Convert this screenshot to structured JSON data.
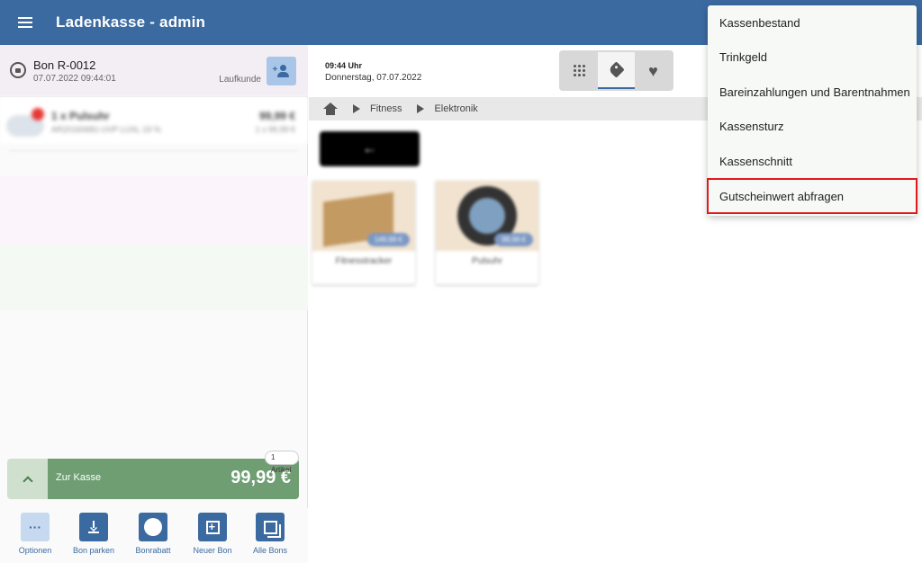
{
  "header": {
    "title": "Ladenkasse - admin",
    "menu_icon": "hamburger-menu-icon"
  },
  "bon": {
    "title": "Bon R-0012",
    "datetime": "07.07.2022 09:44:01",
    "customer": "Laufkunde"
  },
  "cart": {
    "items": [
      {
        "name": "1 x Pulsuhr",
        "sub": "AR20160681-UVP LUXL 19 %",
        "price": "99,99 €",
        "qty_price": "1 x 99,99 €",
        "badge_color": "#e53935"
      }
    ]
  },
  "checkout": {
    "label": "Zur Kasse",
    "total": "99,99 €",
    "article_count": "1 Artikel",
    "color": "#6e9e72"
  },
  "toolbar": {
    "options": "Optionen",
    "park": "Bon parken",
    "discount": "Bonrabatt",
    "new_bon": "Neuer Bon",
    "all_bons": "Alle Bons"
  },
  "main": {
    "time": "09:44 Uhr",
    "date": "Donnerstag,  07.07.2022",
    "tabs": [
      "numpad-icon",
      "tag-icon",
      "heart-icon"
    ],
    "active_tab": 1,
    "breadcrumb": [
      "Fitness",
      "Elektronik"
    ],
    "back_arrow": "←",
    "products": [
      {
        "name": "Fitnesstracker",
        "price": "149,99 €"
      },
      {
        "name": "Pulsuhr",
        "price": "99,99 €"
      }
    ]
  },
  "menu": {
    "items": [
      "Kassenbestand",
      "Trinkgeld",
      "Bareinzahlungen und Barentnahmen",
      "Kassensturz",
      "Kassenschnitt",
      "Gutscheinwert abfragen"
    ],
    "highlighted_index": 5,
    "highlight_color": "#e0191e"
  },
  "colors": {
    "primary": "#3b6aa0",
    "checkout_green": "#6e9e72"
  }
}
